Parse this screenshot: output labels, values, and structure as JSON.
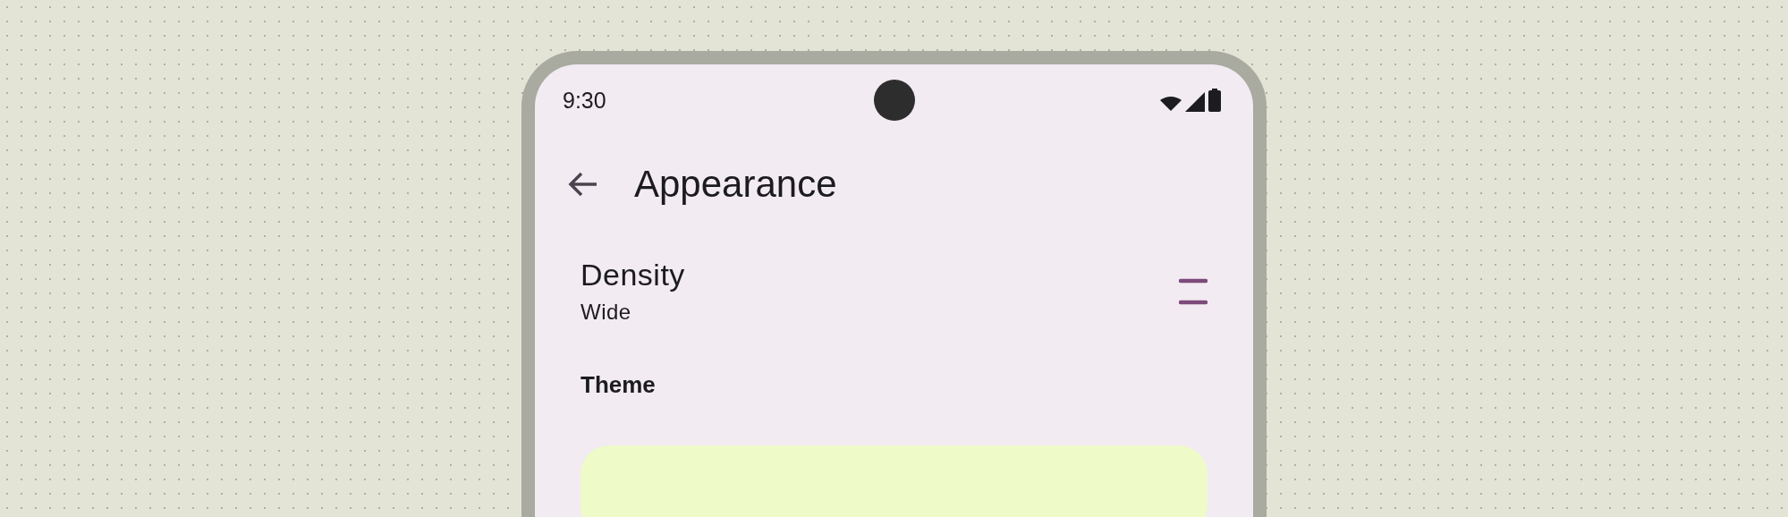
{
  "status_bar": {
    "time": "9:30"
  },
  "app_bar": {
    "title": "Appearance"
  },
  "settings": [
    {
      "kind": "density",
      "title": "Density",
      "value": "Wide"
    }
  ],
  "section_heading": "Theme"
}
